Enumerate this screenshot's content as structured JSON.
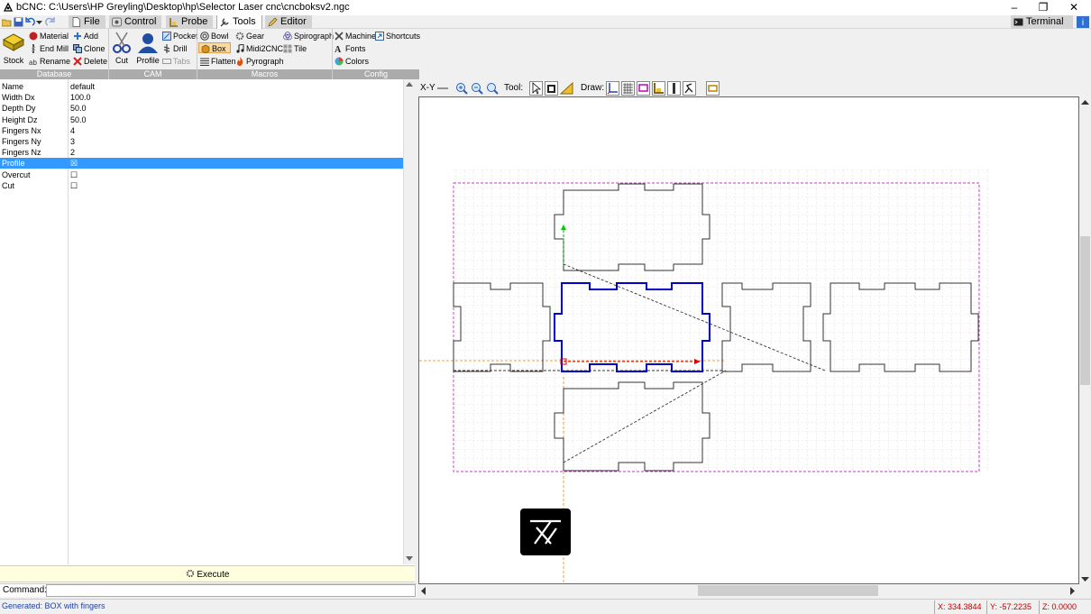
{
  "window": {
    "title": "bCNC: C:\\Users\\HP Greyling\\Desktop\\hp\\Selector Laser  cnc\\cncboksv2.ngc",
    "minimize": "–",
    "restore": "❐",
    "close": "✕"
  },
  "tabs": [
    {
      "label": "File",
      "icon": "file-icon"
    },
    {
      "label": "Control",
      "icon": "control-icon"
    },
    {
      "label": "Probe",
      "icon": "probe-icon"
    },
    {
      "label": "Tools",
      "icon": "tools-icon",
      "active": true
    },
    {
      "label": "Editor",
      "icon": "editor-icon"
    }
  ],
  "terminal_label": "Terminal",
  "ribbon": {
    "database": {
      "label": "Database",
      "stock": "Stock",
      "material": "Material",
      "end_mill": "End Mill",
      "rename": "Rename",
      "add": "Add",
      "clone": "Clone",
      "delete": "Delete"
    },
    "cam": {
      "label": "CAM",
      "cut": "Cut",
      "profile": "Profile",
      "pocket": "Pocket",
      "drill": "Drill",
      "tabs": "Tabs"
    },
    "macros": {
      "label": "Macros",
      "bowl": "Bowl",
      "box": "Box",
      "flatten": "Flatten",
      "gear": "Gear",
      "midi2cnc": "Midi2CNC",
      "pyrograph": "Pyrograph",
      "spirograph": "Spirograph",
      "tile": "Tile"
    },
    "config": {
      "label": "Config",
      "machine": "Machine",
      "fonts": "Fonts",
      "colors": "Colors",
      "shortcuts": "Shortcuts"
    }
  },
  "properties": [
    {
      "name": "Name",
      "value": "default"
    },
    {
      "name": "Width Dx",
      "value": "100.0"
    },
    {
      "name": "Depth Dy",
      "value": "50.0"
    },
    {
      "name": "Height Dz",
      "value": "50.0"
    },
    {
      "name": "Fingers Nx",
      "value": "4"
    },
    {
      "name": "Fingers Ny",
      "value": "3"
    },
    {
      "name": "Fingers Nz",
      "value": "2"
    },
    {
      "name": "Profile",
      "value": "☒",
      "selected": true
    },
    {
      "name": "Overcut",
      "value": "☐"
    },
    {
      "name": "Cut",
      "value": "☐"
    }
  ],
  "execute_label": "Execute",
  "command_label": "Command:",
  "status_text": "Generated: BOX with fingers",
  "coords": {
    "x": "X: 334.3844",
    "y": "Y: -57.2235",
    "z": "Z: 0.0000"
  },
  "canvas_toolbar": {
    "view": "X-Y",
    "tool_label": "Tool:",
    "draw_label": "Draw:"
  },
  "colors": {
    "selected_row": "#3399ff",
    "execute_bg": "#ffffe0",
    "coord_text": "#c00000",
    "selected_part": "#0000cc",
    "margin_box": "#cc33cc"
  }
}
